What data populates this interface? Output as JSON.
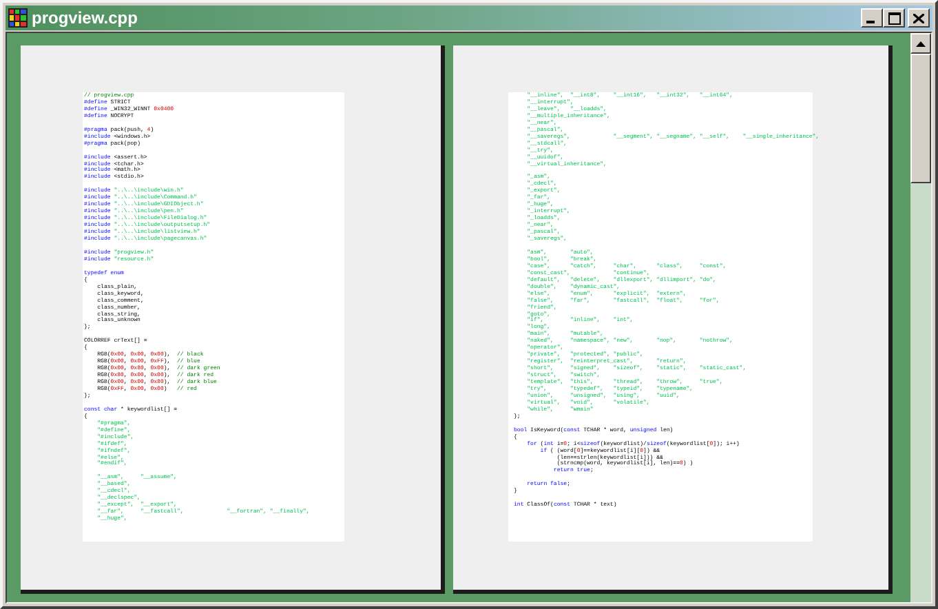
{
  "window": {
    "title": "progview.cpp"
  },
  "pages": [
    {
      "blocks": [
        [
          {
            "kind": "code",
            "segments": [
              {
                "kind": "comment",
                "text": "// progview.cpp"
              }
            ]
          },
          {
            "kind": "code",
            "segments": [
              {
                "kind": "keyword",
                "text": "#define"
              },
              {
                "kind": "plain",
                "text": " STRICT"
              }
            ]
          },
          {
            "kind": "code",
            "segments": [
              {
                "kind": "keyword",
                "text": "#define"
              },
              {
                "kind": "plain",
                "text": " _WIN32_WINNT "
              },
              {
                "kind": "number",
                "text": "0x0400"
              }
            ]
          },
          {
            "kind": "code",
            "segments": [
              {
                "kind": "keyword",
                "text": "#define"
              },
              {
                "kind": "plain",
                "text": " NOCRYPT"
              }
            ]
          }
        ],
        [
          {
            "kind": "code",
            "segments": [
              {
                "kind": "keyword",
                "text": "#pragma"
              },
              {
                "kind": "plain",
                "text": " pack(push, "
              },
              {
                "kind": "number",
                "text": "4"
              },
              {
                "kind": "plain",
                "text": ")"
              }
            ]
          },
          {
            "kind": "code",
            "segments": [
              {
                "kind": "keyword",
                "text": "#include"
              },
              {
                "kind": "plain",
                "text": " <windows.h>"
              }
            ]
          },
          {
            "kind": "code",
            "segments": [
              {
                "kind": "keyword",
                "text": "#pragma"
              },
              {
                "kind": "plain",
                "text": " pack(pop)"
              }
            ]
          }
        ],
        [
          {
            "kind": "code",
            "segments": [
              {
                "kind": "keyword",
                "text": "#include"
              },
              {
                "kind": "plain",
                "text": " <assert.h>"
              }
            ]
          },
          {
            "kind": "code",
            "segments": [
              {
                "kind": "keyword",
                "text": "#include"
              },
              {
                "kind": "plain",
                "text": " <tchar.h>"
              }
            ]
          },
          {
            "kind": "code",
            "segments": [
              {
                "kind": "keyword",
                "text": "#include"
              },
              {
                "kind": "plain",
                "text": " <math.h>"
              }
            ]
          },
          {
            "kind": "code",
            "segments": [
              {
                "kind": "keyword",
                "text": "#include"
              },
              {
                "kind": "plain",
                "text": " <stdio.h>"
              }
            ]
          }
        ],
        [
          {
            "kind": "code",
            "segments": [
              {
                "kind": "keyword",
                "text": "#include"
              },
              {
                "kind": "string",
                "text": " \"..\\..\\include\\win.h\""
              }
            ]
          },
          {
            "kind": "code",
            "segments": [
              {
                "kind": "keyword",
                "text": "#include"
              },
              {
                "kind": "string",
                "text": " \"..\\..\\include\\Command.h\""
              }
            ]
          },
          {
            "kind": "code",
            "segments": [
              {
                "kind": "keyword",
                "text": "#include"
              },
              {
                "kind": "string",
                "text": " \"..\\..\\include\\GDIObject.h\""
              }
            ]
          },
          {
            "kind": "code",
            "segments": [
              {
                "kind": "keyword",
                "text": "#include"
              },
              {
                "kind": "string",
                "text": " \"..\\..\\include\\pen.h\""
              }
            ]
          },
          {
            "kind": "code",
            "segments": [
              {
                "kind": "keyword",
                "text": "#include"
              },
              {
                "kind": "string",
                "text": " \"..\\..\\include\\FileDialog.h\""
              }
            ]
          },
          {
            "kind": "code",
            "segments": [
              {
                "kind": "keyword",
                "text": "#include"
              },
              {
                "kind": "string",
                "text": " \"..\\..\\include\\outputsetup.h\""
              }
            ]
          },
          {
            "kind": "code",
            "segments": [
              {
                "kind": "keyword",
                "text": "#include"
              },
              {
                "kind": "string",
                "text": " \"..\\..\\include\\listview.h\""
              }
            ]
          },
          {
            "kind": "code",
            "segments": [
              {
                "kind": "keyword",
                "text": "#include"
              },
              {
                "kind": "string",
                "text": " \"..\\..\\include\\pagecanvas.h\""
              }
            ]
          }
        ],
        [
          {
            "kind": "code",
            "segments": [
              {
                "kind": "keyword",
                "text": "#include"
              },
              {
                "kind": "string",
                "text": " \"progview.h\""
              }
            ]
          },
          {
            "kind": "code",
            "segments": [
              {
                "kind": "keyword",
                "text": "#include"
              },
              {
                "kind": "string",
                "text": " \"resource.h\""
              }
            ]
          }
        ],
        [
          {
            "kind": "code",
            "segments": [
              {
                "kind": "keyword",
                "text": "typedef enum"
              }
            ]
          },
          {
            "kind": "code",
            "segments": [
              {
                "kind": "plain",
                "text": "{"
              }
            ]
          },
          {
            "kind": "code",
            "segments": [
              {
                "kind": "plain",
                "text": "    class_plain,"
              }
            ]
          },
          {
            "kind": "code",
            "segments": [
              {
                "kind": "plain",
                "text": "    class_keyword,"
              }
            ]
          },
          {
            "kind": "code",
            "segments": [
              {
                "kind": "plain",
                "text": "    class_comment,"
              }
            ]
          },
          {
            "kind": "code",
            "segments": [
              {
                "kind": "plain",
                "text": "    class_number,"
              }
            ]
          },
          {
            "kind": "code",
            "segments": [
              {
                "kind": "plain",
                "text": "    class_string,"
              }
            ]
          },
          {
            "kind": "code",
            "segments": [
              {
                "kind": "plain",
                "text": "    class_unknown"
              }
            ]
          },
          {
            "kind": "code",
            "segments": [
              {
                "kind": "plain",
                "text": "};"
              }
            ]
          }
        ],
        [
          {
            "kind": "code",
            "segments": [
              {
                "kind": "plain",
                "text": "COLORREF crText[] ="
              }
            ]
          },
          {
            "kind": "code",
            "segments": [
              {
                "kind": "plain",
                "text": "{"
              }
            ]
          },
          {
            "kind": "code",
            "segments": [
              {
                "kind": "plain",
                "text": "    RGB("
              },
              {
                "kind": "number",
                "text": "0x00"
              },
              {
                "kind": "plain",
                "text": ", "
              },
              {
                "kind": "number",
                "text": "0x00"
              },
              {
                "kind": "plain",
                "text": ", "
              },
              {
                "kind": "number",
                "text": "0x00"
              },
              {
                "kind": "plain",
                "text": "),  "
              },
              {
                "kind": "comment",
                "text": "// black"
              }
            ]
          },
          {
            "kind": "code",
            "segments": [
              {
                "kind": "plain",
                "text": "    RGB("
              },
              {
                "kind": "number",
                "text": "0x00"
              },
              {
                "kind": "plain",
                "text": ", "
              },
              {
                "kind": "number",
                "text": "0x00"
              },
              {
                "kind": "plain",
                "text": ", "
              },
              {
                "kind": "number",
                "text": "0xFF"
              },
              {
                "kind": "plain",
                "text": "),  "
              },
              {
                "kind": "comment",
                "text": "// blue"
              }
            ]
          },
          {
            "kind": "code",
            "segments": [
              {
                "kind": "plain",
                "text": "    RGB("
              },
              {
                "kind": "number",
                "text": "0x00"
              },
              {
                "kind": "plain",
                "text": ", "
              },
              {
                "kind": "number",
                "text": "0x80"
              },
              {
                "kind": "plain",
                "text": ", "
              },
              {
                "kind": "number",
                "text": "0x00"
              },
              {
                "kind": "plain",
                "text": "),  "
              },
              {
                "kind": "comment",
                "text": "// dark green"
              }
            ]
          },
          {
            "kind": "code",
            "segments": [
              {
                "kind": "plain",
                "text": "    RGB("
              },
              {
                "kind": "number",
                "text": "0x80"
              },
              {
                "kind": "plain",
                "text": ", "
              },
              {
                "kind": "number",
                "text": "0x00"
              },
              {
                "kind": "plain",
                "text": ", "
              },
              {
                "kind": "number",
                "text": "0x00"
              },
              {
                "kind": "plain",
                "text": "),  "
              },
              {
                "kind": "comment",
                "text": "// dark red"
              }
            ]
          },
          {
            "kind": "code",
            "segments": [
              {
                "kind": "plain",
                "text": "    RGB("
              },
              {
                "kind": "number",
                "text": "0x00"
              },
              {
                "kind": "plain",
                "text": ", "
              },
              {
                "kind": "number",
                "text": "0x00"
              },
              {
                "kind": "plain",
                "text": ", "
              },
              {
                "kind": "number",
                "text": "0x80"
              },
              {
                "kind": "plain",
                "text": "),  "
              },
              {
                "kind": "comment",
                "text": "// dark blue"
              }
            ]
          },
          {
            "kind": "code",
            "segments": [
              {
                "kind": "plain",
                "text": "    RGB("
              },
              {
                "kind": "number",
                "text": "0xFF"
              },
              {
                "kind": "plain",
                "text": ", "
              },
              {
                "kind": "number",
                "text": "0x00"
              },
              {
                "kind": "plain",
                "text": ", "
              },
              {
                "kind": "number",
                "text": "0x00"
              },
              {
                "kind": "plain",
                "text": ")   "
              },
              {
                "kind": "comment",
                "text": "// red"
              }
            ]
          },
          {
            "kind": "code",
            "segments": [
              {
                "kind": "plain",
                "text": "};"
              }
            ]
          }
        ],
        [
          {
            "kind": "code",
            "segments": [
              {
                "kind": "keyword",
                "text": "const char"
              },
              {
                "kind": "plain",
                "text": " * keywordlist[] ="
              }
            ]
          },
          {
            "kind": "code",
            "segments": [
              {
                "kind": "plain",
                "text": "{"
              }
            ]
          },
          {
            "kind": "list",
            "items": [
              "\"#pragma\","
            ]
          },
          {
            "kind": "list",
            "items": [
              "\"#define\","
            ]
          },
          {
            "kind": "list",
            "items": [
              "\"#include\","
            ]
          },
          {
            "kind": "list",
            "items": [
              "\"#ifdef\","
            ]
          },
          {
            "kind": "list",
            "items": [
              "\"#ifndef\","
            ]
          },
          {
            "kind": "list",
            "items": [
              "\"#else\","
            ]
          },
          {
            "kind": "list",
            "items": [
              "\"#endif\","
            ]
          }
        ],
        [
          {
            "kind": "list",
            "items": [
              "\"__asm\",",
              "\"__assume\","
            ]
          },
          {
            "kind": "list",
            "items": [
              "\"__based\","
            ]
          },
          {
            "kind": "list",
            "items": [
              "\"__cdecl\","
            ]
          },
          {
            "kind": "list",
            "items": [
              "\"__declspec\","
            ]
          },
          {
            "kind": "list",
            "items": [
              "\"__except\",",
              "\"__export\","
            ]
          },
          {
            "kind": "list",
            "items": [
              "\"__far\",",
              "\"__fastcall\",",
              "\"__fortran\",",
              "\"__finally\","
            ]
          },
          {
            "kind": "list",
            "items": [
              "\"__huge\","
            ]
          }
        ]
      ]
    },
    {
      "blocks": [
        [
          {
            "kind": "list",
            "items": [
              "\"__inline\",",
              "\"__int8\",",
              "\"__int16\",",
              "\"__int32\",",
              "\"__int64\","
            ]
          },
          {
            "kind": "list",
            "items": [
              "\"__interrupt\","
            ]
          },
          {
            "kind": "list",
            "items": [
              "\"__leave\",",
              "\"__loadds\","
            ]
          },
          {
            "kind": "list",
            "items": [
              "\"__multiple_inheritance\","
            ]
          },
          {
            "kind": "list",
            "items": [
              "\"__near\","
            ]
          },
          {
            "kind": "list",
            "items": [
              "\"__pascal\","
            ]
          },
          {
            "kind": "list",
            "items": [
              "\"__saveregs\",",
              "\"__segment\",",
              "\"__segname\",",
              "\"__self\",",
              "\"__single_inheritance\","
            ]
          },
          {
            "kind": "list",
            "items": [
              "\"__stdcall\","
            ]
          },
          {
            "kind": "list",
            "items": [
              "\"__try\","
            ]
          },
          {
            "kind": "list",
            "items": [
              "\"__uuidof\","
            ]
          },
          {
            "kind": "list",
            "items": [
              "\"__virtual_inheritance\","
            ]
          }
        ],
        [
          {
            "kind": "list",
            "items": [
              "\"_asm\","
            ]
          },
          {
            "kind": "list",
            "items": [
              "\"_cdecl\","
            ]
          },
          {
            "kind": "list",
            "items": [
              "\"_export\","
            ]
          },
          {
            "kind": "list",
            "items": [
              "\"_far\","
            ]
          },
          {
            "kind": "list",
            "items": [
              "\"_huge\","
            ]
          },
          {
            "kind": "list",
            "items": [
              "\"_interrupt\","
            ]
          },
          {
            "kind": "list",
            "items": [
              "\"_loadds\","
            ]
          },
          {
            "kind": "list",
            "items": [
              "\"_near\","
            ]
          },
          {
            "kind": "list",
            "items": [
              "\"_pascal\","
            ]
          },
          {
            "kind": "list",
            "items": [
              "\"_saveregs\","
            ]
          }
        ],
        [
          {
            "kind": "list",
            "items": [
              "\"asm\",",
              "\"auto\","
            ]
          },
          {
            "kind": "list",
            "items": [
              "\"bool\",",
              "\"break\","
            ]
          },
          {
            "kind": "list",
            "items": [
              "\"case\",",
              "\"catch\",",
              "\"char\",",
              "\"class\",",
              "\"const\","
            ]
          },
          {
            "kind": "list",
            "items": [
              "\"const_cast\",",
              "\"continue\","
            ]
          },
          {
            "kind": "list",
            "items": [
              "\"default\",",
              "\"delete\",",
              "\"dllexport\",",
              "\"dllimport\",",
              "\"do\","
            ]
          },
          {
            "kind": "list",
            "items": [
              "\"double\",",
              "\"dynamic_cast\","
            ]
          },
          {
            "kind": "list",
            "items": [
              "\"else\",",
              "\"enum\",",
              "\"explicit\",",
              "\"extern\","
            ]
          },
          {
            "kind": "list",
            "items": [
              "\"false\",",
              "\"far\",",
              "\"fastcall\",",
              "\"float\",",
              "\"for\","
            ]
          },
          {
            "kind": "list",
            "items": [
              "\"friend\","
            ]
          },
          {
            "kind": "list",
            "items": [
              "\"goto\","
            ]
          },
          {
            "kind": "list",
            "items": [
              "\"if\",",
              "\"inline\",",
              "\"int\","
            ]
          },
          {
            "kind": "list",
            "items": [
              "\"long\","
            ]
          },
          {
            "kind": "list",
            "items": [
              "\"main\",",
              "\"mutable\","
            ]
          },
          {
            "kind": "list",
            "items": [
              "\"naked\",",
              "\"namespace\",",
              "\"new\",",
              "\"nop\",",
              "\"nothrow\","
            ]
          },
          {
            "kind": "list",
            "items": [
              "\"operator\","
            ]
          },
          {
            "kind": "list",
            "items": [
              "\"private\",",
              "\"protected\",",
              "\"public\","
            ]
          },
          {
            "kind": "list",
            "items": [
              "\"register\",",
              "\"reinterpret_cast\",",
              "\"return\","
            ]
          },
          {
            "kind": "list",
            "items": [
              "\"short\",",
              "\"signed\",",
              "\"sizeof\",",
              "\"static\",",
              "\"static_cast\","
            ]
          },
          {
            "kind": "list",
            "items": [
              "\"struct\",",
              "\"switch\","
            ]
          },
          {
            "kind": "list",
            "items": [
              "\"template\",",
              "\"this\",",
              "\"thread\",",
              "\"throw\",",
              "\"true\","
            ]
          },
          {
            "kind": "list",
            "items": [
              "\"try\",",
              "\"typedef\",",
              "\"typeid\",",
              "\"typename\","
            ]
          },
          {
            "kind": "list",
            "items": [
              "\"union\",",
              "\"unsigned\",",
              "\"using\",",
              "\"uuid\","
            ]
          },
          {
            "kind": "list",
            "items": [
              "\"virtual\",",
              "\"void\",",
              "\"volatile\","
            ]
          },
          {
            "kind": "list",
            "items": [
              "\"while\",",
              "\"wmain\""
            ]
          },
          {
            "kind": "code",
            "segments": [
              {
                "kind": "plain",
                "text": "};"
              }
            ]
          }
        ],
        [
          {
            "kind": "code",
            "segments": [
              {
                "kind": "keyword",
                "text": "bool"
              },
              {
                "kind": "plain",
                "text": " IsKeyword("
              },
              {
                "kind": "keyword",
                "text": "const"
              },
              {
                "kind": "plain",
                "text": " TCHAR * word, "
              },
              {
                "kind": "keyword",
                "text": "unsigned"
              },
              {
                "kind": "plain",
                "text": " len)"
              }
            ]
          },
          {
            "kind": "code",
            "segments": [
              {
                "kind": "plain",
                "text": "{"
              }
            ]
          },
          {
            "kind": "code",
            "segments": [
              {
                "kind": "keyword",
                "text": "    for"
              },
              {
                "kind": "plain",
                "text": " ("
              },
              {
                "kind": "keyword",
                "text": "int"
              },
              {
                "kind": "plain",
                "text": " i="
              },
              {
                "kind": "number",
                "text": "0"
              },
              {
                "kind": "plain",
                "text": "; i<"
              },
              {
                "kind": "keyword",
                "text": "sizeof"
              },
              {
                "kind": "plain",
                "text": "(keywordlist)/"
              },
              {
                "kind": "keyword",
                "text": "sizeof"
              },
              {
                "kind": "plain",
                "text": "(keywordlist["
              },
              {
                "kind": "number",
                "text": "0"
              },
              {
                "kind": "plain",
                "text": "]); i++)"
              }
            ]
          },
          {
            "kind": "code",
            "segments": [
              {
                "kind": "keyword",
                "text": "        if"
              },
              {
                "kind": "plain",
                "text": " ( (word["
              },
              {
                "kind": "number",
                "text": "0"
              },
              {
                "kind": "plain",
                "text": "]==keywordlist[i]["
              },
              {
                "kind": "number",
                "text": "0"
              },
              {
                "kind": "plain",
                "text": "]) &&"
              }
            ]
          },
          {
            "kind": "code",
            "segments": [
              {
                "kind": "plain",
                "text": "             (len==strlen(keywordlist[i])) &&"
              }
            ]
          },
          {
            "kind": "code",
            "segments": [
              {
                "kind": "plain",
                "text": "             (strncmp(word, keywordlist[i], len)=="
              },
              {
                "kind": "number",
                "text": "0"
              },
              {
                "kind": "plain",
                "text": ") )"
              }
            ]
          },
          {
            "kind": "code",
            "segments": [
              {
                "kind": "keyword",
                "text": "            return true"
              },
              {
                "kind": "plain",
                "text": ";"
              }
            ]
          }
        ],
        [
          {
            "kind": "code",
            "segments": [
              {
                "kind": "keyword",
                "text": "    return false"
              },
              {
                "kind": "plain",
                "text": ";"
              }
            ]
          },
          {
            "kind": "code",
            "segments": [
              {
                "kind": "plain",
                "text": "}"
              }
            ]
          }
        ],
        [
          {
            "kind": "code",
            "segments": [
              {
                "kind": "keyword",
                "text": "int"
              },
              {
                "kind": "plain",
                "text": " ClassOf("
              },
              {
                "kind": "keyword",
                "text": "const"
              },
              {
                "kind": "plain",
                "text": " TCHAR * text)"
              }
            ]
          }
        ]
      ]
    }
  ]
}
